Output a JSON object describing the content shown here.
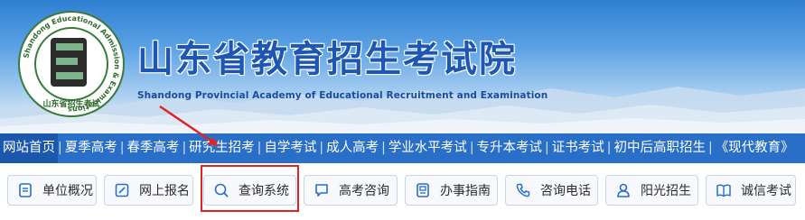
{
  "header": {
    "title_cn": "山东省教育招生考试院",
    "title_en": "Shandong Provincial Academy of Educational Recruitment and Examination",
    "logo": {
      "ring_text": "Shandong Educational Admission & Examinations",
      "bottom_text": "山东省招生考试",
      "center_letter": "E"
    }
  },
  "nav": {
    "items": [
      {
        "label": "网站首页",
        "active": true
      },
      {
        "label": "夏季高考"
      },
      {
        "label": "春季高考"
      },
      {
        "label": "研究生招考"
      },
      {
        "label": "自学考试"
      },
      {
        "label": "成人高考"
      },
      {
        "label": "学业水平考试"
      },
      {
        "label": "专升本考试"
      },
      {
        "label": "证书考试"
      },
      {
        "label": "初中后高职招生"
      },
      {
        "label": "《现代教育》"
      }
    ],
    "separator": "|"
  },
  "buttons": [
    {
      "label": "单位概况",
      "icon": "document-icon"
    },
    {
      "label": "网上报名",
      "icon": "edit-icon"
    },
    {
      "label": "查询系统",
      "icon": "search-icon"
    },
    {
      "label": "高考咨询",
      "icon": "chat-icon"
    },
    {
      "label": "办事指南",
      "icon": "guide-icon"
    },
    {
      "label": "咨询电话",
      "icon": "phone-icon"
    },
    {
      "label": "阳光招生",
      "icon": "user-icon"
    },
    {
      "label": "诚信考试",
      "icon": "book-icon"
    }
  ],
  "colors": {
    "nav_bg": "#2a6fc7",
    "title": "#1e56b4",
    "highlight": "#e02424"
  }
}
